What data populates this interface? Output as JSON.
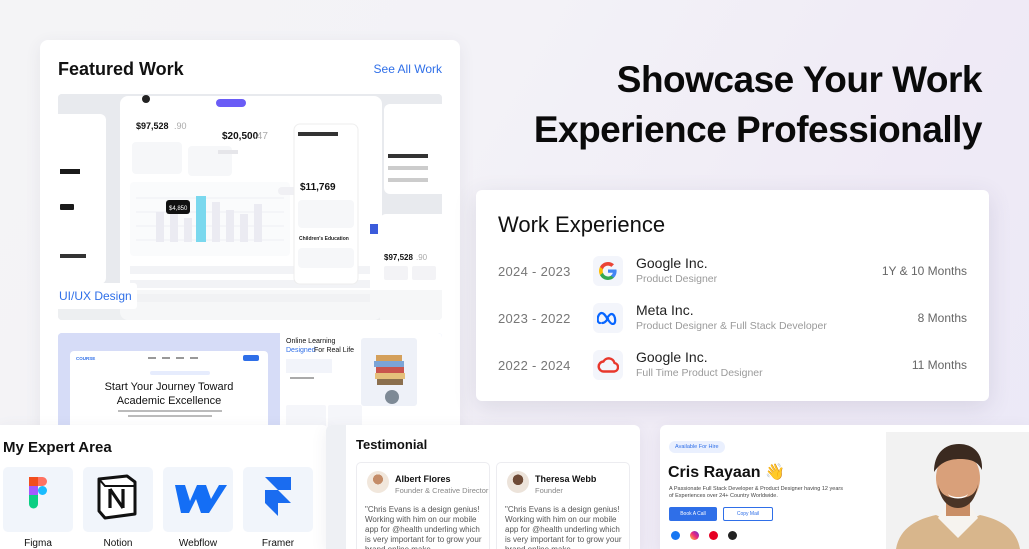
{
  "featured": {
    "title": "Featured Work",
    "see_all": "See All Work",
    "tag": "UI/UX Design",
    "dashboard": {
      "balance1": "$97,528",
      "balance1_dec": ".90",
      "balance2": "$20,500",
      "balance2_dec": ".47",
      "side_amount": "$11,769",
      "side_card": "Children's Education",
      "right_balance": "$97,528",
      "right_dec": ".90",
      "chart_value": "$4,850"
    },
    "education": {
      "brand": "COURSE",
      "headline1": "Start Your Journey Toward",
      "headline2": "Academic Excellence",
      "side_title1": "Online Learning",
      "side_title2a": "Designed",
      "side_title2b": "For Real Life"
    }
  },
  "hero": {
    "line1": "Showcase Your Work",
    "line2": "Experience Professionally"
  },
  "work": {
    "title": "Work Experience",
    "rows": [
      {
        "years": "2024 - 2023",
        "company": "Google Inc.",
        "role": "Product Designer",
        "duration": "1Y & 10 Months",
        "logo": "google-logo"
      },
      {
        "years": "2023 - 2022",
        "company": "Meta Inc.",
        "role": "Product Designer & Full Stack Developer",
        "duration": "8 Months",
        "logo": "meta-logo"
      },
      {
        "years": "2022 - 2024",
        "company": "Google Inc.",
        "role": "Full Time Product Designer",
        "duration": "11 Months",
        "logo": "creative-cloud-logo"
      }
    ]
  },
  "expert": {
    "title": "My Expert Area",
    "tools": [
      {
        "label": "Figma",
        "icon": "figma-icon"
      },
      {
        "label": "Notion",
        "icon": "notion-icon"
      },
      {
        "label": "Webflow",
        "icon": "webflow-icon"
      },
      {
        "label": "Framer",
        "icon": "framer-icon"
      }
    ]
  },
  "testimonial": {
    "title": "Testimonial",
    "cards": [
      {
        "name": "Albert Flores",
        "role": "Founder & Creative Director",
        "quote": "\"Chris Evans is a design genius! Working with him on our mobile app for @health underling which is very important for to grow your brand online make"
      },
      {
        "name": "Theresa Webb",
        "role": "Founder",
        "quote": "\"Chris Evans is a design genius! Working with him on our mobile app for @health underling which is very important for to grow your brand online make"
      }
    ]
  },
  "profile": {
    "badge": "Available For Hire",
    "name": "Cris Rayaan 👋",
    "bio": "A Passionate Full Stack Developer & Product Designer having 12 years of Experiences over 24+ Country Worldwide.",
    "book_call": "Book A Call",
    "copy_mail": "Copy Mail"
  },
  "colors": {
    "accent": "#2f6fe8",
    "google_blue": "#4285F4",
    "google_red": "#EA4335",
    "google_yellow": "#FBBC05",
    "google_green": "#34A853",
    "meta_blue": "#0866FF",
    "framer_blue": "#1a6cf0",
    "webflow_blue": "#146ef5"
  }
}
